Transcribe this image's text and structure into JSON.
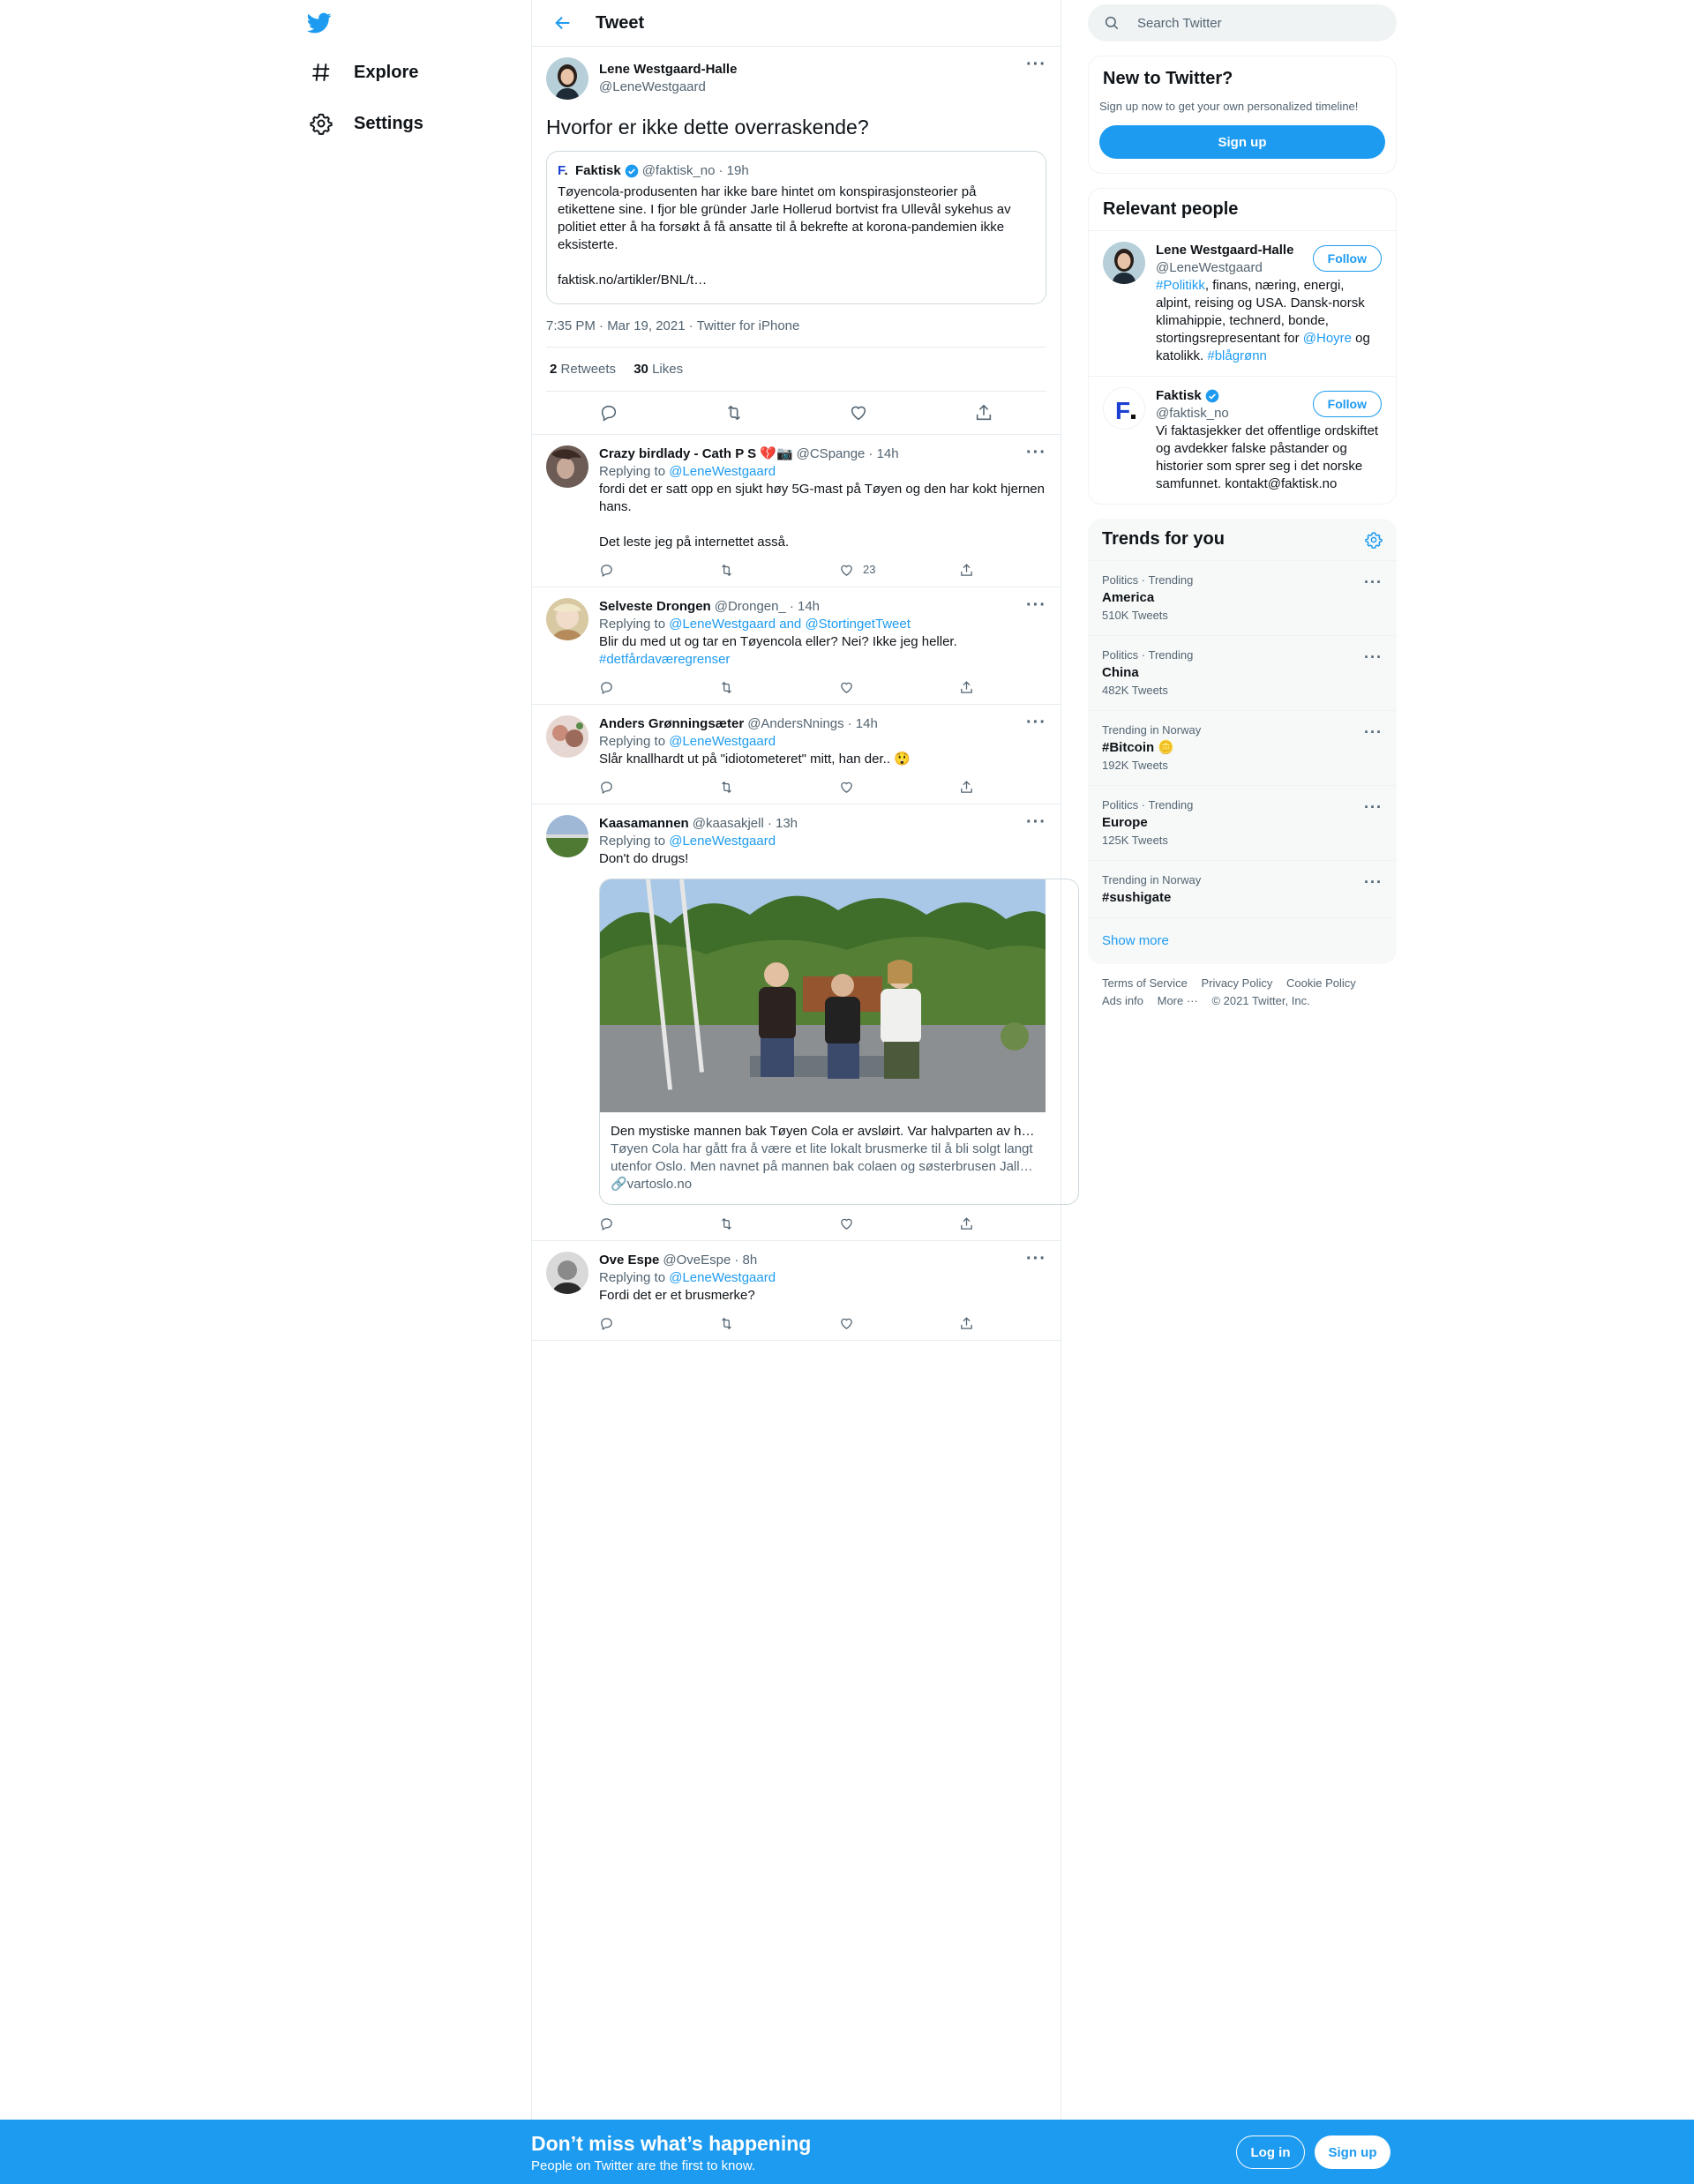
{
  "nav": {
    "explore": "Explore",
    "settings": "Settings"
  },
  "header": {
    "title": "Tweet"
  },
  "focal": {
    "name": "Lene Westgaard-Halle",
    "handle": "@LeneWestgaard",
    "text": "Hvorfor er ikke dette overraskende?",
    "quote": {
      "name": "Faktisk",
      "handle": "@faktisk_no",
      "time": "· 19h",
      "text": "Tøyencola-produsenten har ikke bare hintet om konspirasjonsteorier på etikettene sine. I fjor ble gründer Jarle Hollerud bortvist fra Ullevål sykehus av politiet etter å ha forsøkt å få ansatte til å bekrefte at korona-pandemien ikke eksisterte.\n\nfaktisk.no/artikler/BNL/t…"
    },
    "timestamp": "7:35 PM · Mar 19, 2021 · Twitter for iPhone",
    "retweets_num": "2",
    "retweets_label": "Retweets",
    "likes_num": "30",
    "likes_label": "Likes"
  },
  "replying_label": "Replying to",
  "replies": [
    {
      "name": "Crazy birdlady - Cath P S 💔📷",
      "handle": "@CSpange",
      "time": "· 14h",
      "to": "@LeneWestgaard",
      "text": "fordi det er satt opp en sjukt høy 5G-mast på Tøyen og den har kokt hjernen hans.\n\nDet leste jeg på internettet asså.",
      "likes": "23"
    },
    {
      "name": "Selveste Drongen",
      "handle": "@Drongen_",
      "time": "· 14h",
      "to": "@LeneWestgaard and @StortingetTweet",
      "text": "Blir du med ut og tar en Tøyencola eller? Nei? Ikke jeg heller.",
      "hashtag": "#detfårdaværegrenser",
      "likes": ""
    },
    {
      "name": "Anders Grønningsæter",
      "handle": "@AndersNnings",
      "time": "· 14h",
      "to": "@LeneWestgaard",
      "text": "Slår knallhardt ut på \"idiotometeret\" mitt, han der.. 😲",
      "likes": ""
    },
    {
      "name": "Kaasamannen",
      "handle": "@kaasakjell",
      "time": "· 13h",
      "to": "@LeneWestgaard",
      "text": "Don't do drugs!",
      "likes": "",
      "card": {
        "title": "Den mystiske mannen bak Tøyen Cola er avsløirt. Var halvparten av h…",
        "desc": "Tøyen Cola har gått fra å være et lite lokalt brusmerke til å bli solgt langt utenfor Oslo. Men navnet på mannen bak colaen og søsterbrusen Jall…",
        "domain": "vartoslo.no"
      }
    },
    {
      "name": "Ove Espe",
      "handle": "@OveEspe",
      "time": "· 8h",
      "to": "@LeneWestgaard",
      "text": "Fordi det er et brusmerke?",
      "likes": ""
    }
  ],
  "right": {
    "search_placeholder": "Search Twitter",
    "new": {
      "title": "New to Twitter?",
      "sub": "Sign up now to get your own personalized timeline!",
      "button": "Sign up"
    },
    "relevant": {
      "title": "Relevant people",
      "follow": "Follow",
      "people": [
        {
          "name": "Lene Westgaard-Halle",
          "handle": "@LeneWestgaard",
          "bio_tag1": "#Politikk",
          "bio_text1": ", finans, næring, energi, alpint, reising og USA. Dansk-norsk klimahippie, technerd, bonde, stortingsrepresentant for ",
          "bio_tag2": "@Hoyre",
          "bio_text2": " og katolikk. ",
          "bio_tag3": "#blågrønn"
        },
        {
          "name": "Faktisk",
          "handle": "@faktisk_no",
          "bio": "Vi faktasjekker det offentlige ordskiftet og avdekker falske påstander og historier som sprer seg i det norske samfunnet. kontakt@faktisk.no"
        }
      ]
    },
    "trends": {
      "title": "Trends for you",
      "items": [
        {
          "meta": "Politics · Trending",
          "name": "America",
          "count": "510K Tweets"
        },
        {
          "meta": "Politics · Trending",
          "name": "China",
          "count": "482K Tweets"
        },
        {
          "meta": "Trending in Norway",
          "name": "#Bitcoin 🪙",
          "count": "192K Tweets"
        },
        {
          "meta": "Politics · Trending",
          "name": "Europe",
          "count": "125K Tweets"
        },
        {
          "meta": "Trending in Norway",
          "name": "#sushigate",
          "count": ""
        }
      ],
      "show_more": "Show more"
    },
    "footer": {
      "terms": "Terms of Service",
      "privacy": "Privacy Policy",
      "cookie": "Cookie Policy",
      "ads": "Ads info",
      "more": "More ···",
      "copyright": "© 2021 Twitter, Inc."
    }
  },
  "bottom": {
    "title": "Don’t miss what’s happening",
    "sub": "People on Twitter are the first to know.",
    "login": "Log in",
    "signup": "Sign up"
  },
  "colors": {
    "accent": "#1d9bf0",
    "text": "#0f1419",
    "secondary": "#536471"
  }
}
